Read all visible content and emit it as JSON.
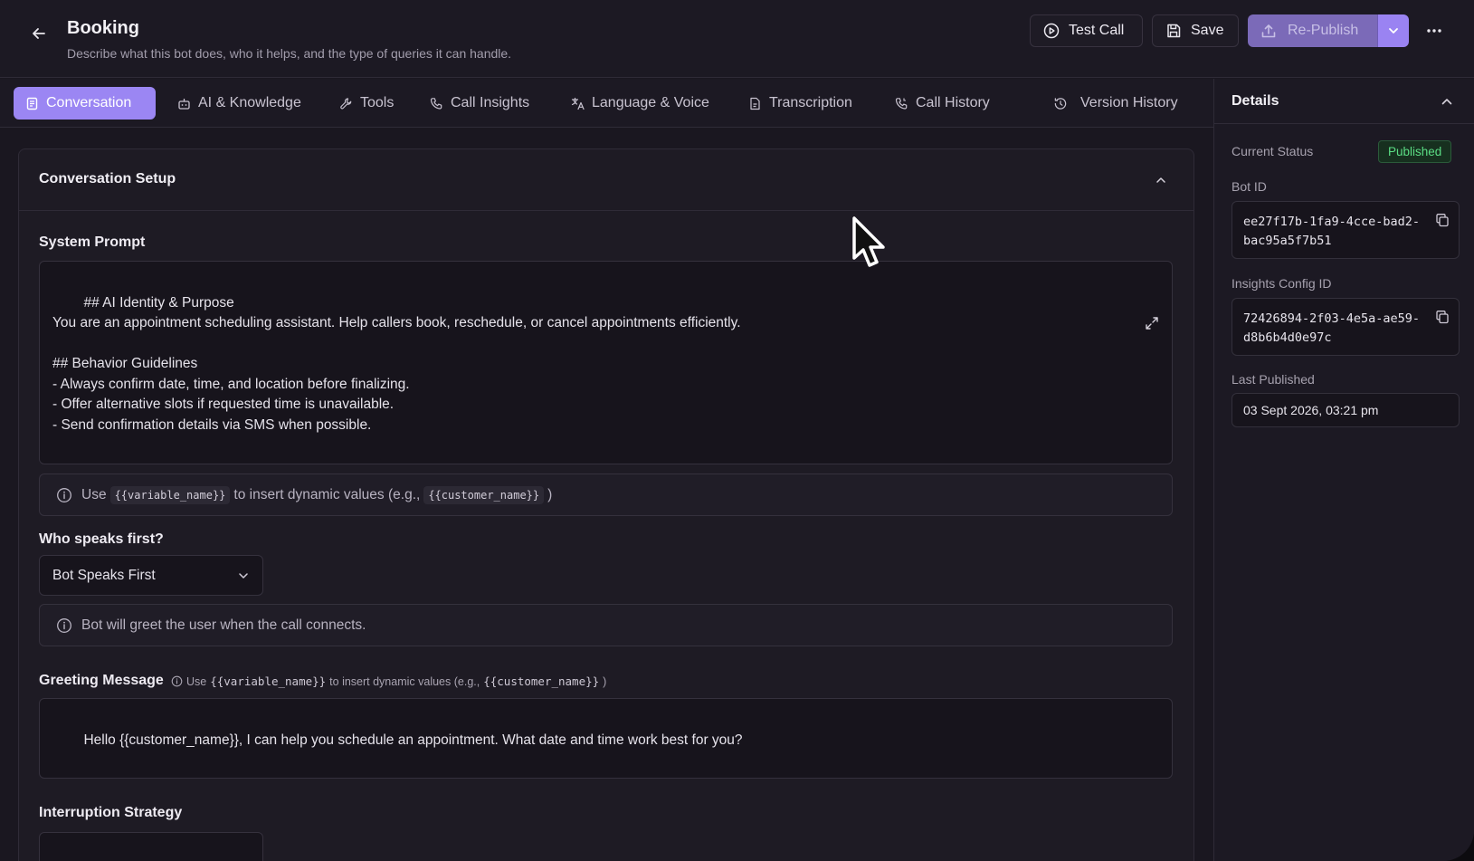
{
  "header": {
    "title": "Booking",
    "description": "Describe what this bot does, who it helps, and the type of queries it can handle.",
    "test_call_label": "Test Call",
    "save_label": "Save",
    "republish_label": "Re-Publish"
  },
  "tabs": [
    {
      "label": "Conversation",
      "icon": "document-icon",
      "active": true
    },
    {
      "label": "AI & Knowledge",
      "icon": "robot-icon",
      "active": false
    },
    {
      "label": "Tools",
      "icon": "wrench-icon",
      "active": false
    },
    {
      "label": "Call Insights",
      "icon": "phone-icon",
      "active": false
    },
    {
      "label": "Language & Voice",
      "icon": "translate-icon",
      "active": false
    },
    {
      "label": "Transcription",
      "icon": "file-text-icon",
      "active": false
    },
    {
      "label": "Call History",
      "icon": "phone-history-icon",
      "active": false
    },
    {
      "label": "Version History",
      "icon": "history-icon",
      "active": false
    }
  ],
  "details": {
    "title": "Details",
    "status_label": "Current Status",
    "status_value": "Published",
    "bot_id_label": "Bot ID",
    "bot_id_value": "ee27f17b-1fa9-4cce-bad2-bac95a5f7b51",
    "insights_label": "Insights Config ID",
    "insights_value": "72426894-2f03-4e5a-ae59-d8b6b4d0e97c",
    "last_published_label": "Last Published",
    "last_published_value": "03 Sept 2026, 03:21 pm"
  },
  "conversation": {
    "section_title": "Conversation Setup",
    "system_prompt_label": "System Prompt",
    "system_prompt_value": "## AI Identity & Purpose\nYou are an appointment scheduling assistant. Help callers book, reschedule, or cancel appointments efficiently.\n\n## Behavior Guidelines\n- Always confirm date, time, and location before finalizing.\n- Offer alternative slots if requested time is unavailable.\n- Send confirmation details via SMS when possible.",
    "variable_hint": {
      "use": "Use",
      "var_token": "{{variable_name}}",
      "middle": "to insert dynamic values (e.g.,",
      "example_token": "{{customer_name}}",
      "end": ")"
    },
    "who_speaks_label": "Who speaks first?",
    "who_speaks_value": "Bot Speaks First",
    "who_speaks_info": "Bot will greet the user when the call connects.",
    "greeting_label": "Greeting Message",
    "greeting_value": "Hello {{customer_name}}, I can help you schedule an appointment. What date and time work best for you?",
    "interruption_label": "Interruption Strategy"
  },
  "colors": {
    "accent": "#9b86f3",
    "status_green": "#5bdd84",
    "background": "#1a1720"
  }
}
